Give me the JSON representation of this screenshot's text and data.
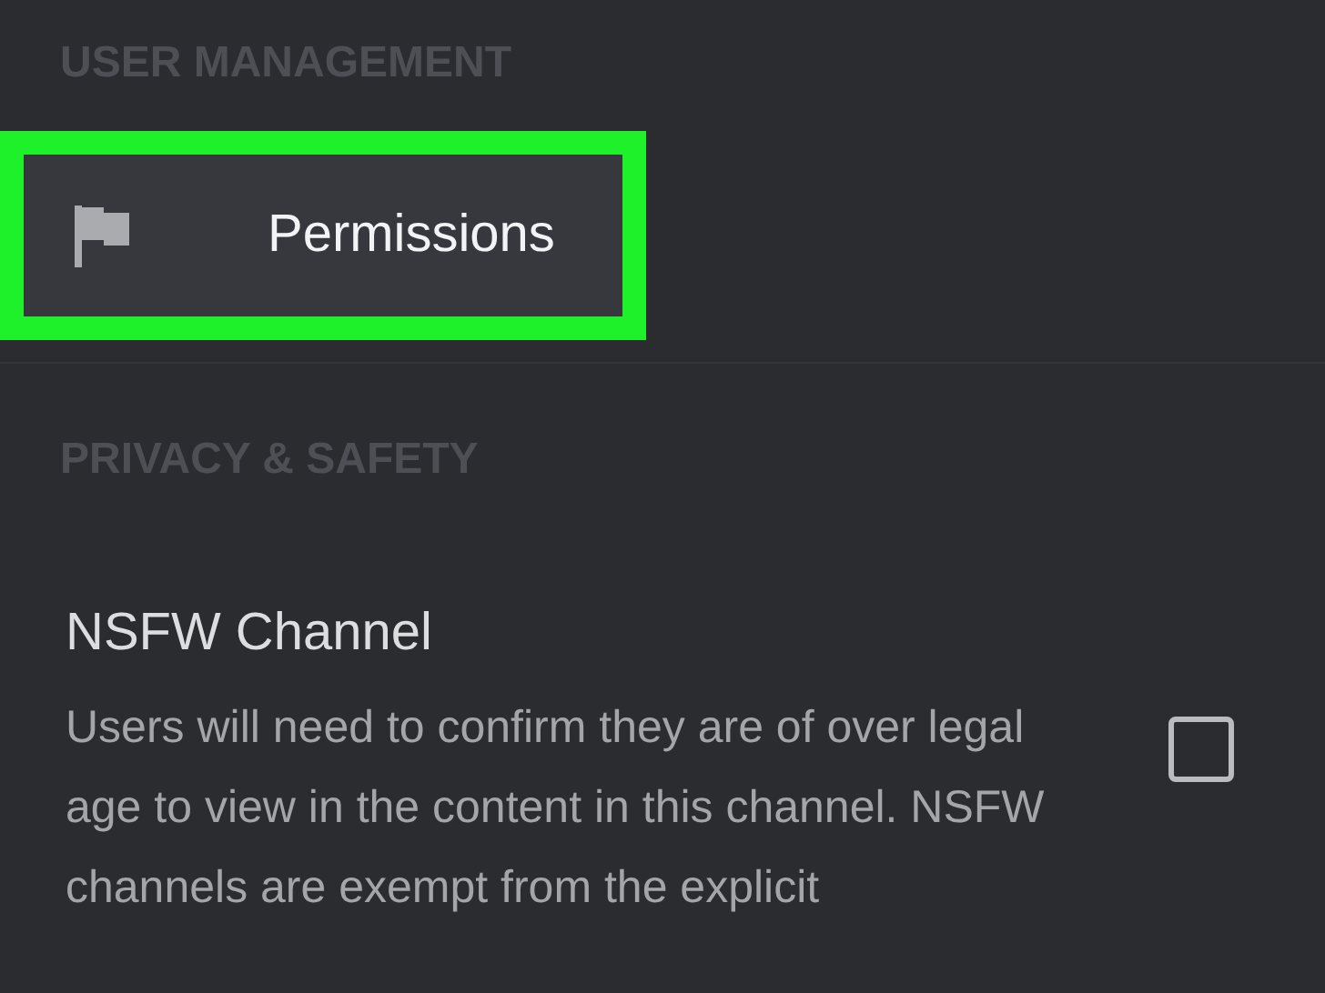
{
  "sections": [
    {
      "heading": "USER MANAGEMENT",
      "items": [
        {
          "kind": "nav",
          "label": "Permissions",
          "highlighted": true
        }
      ]
    },
    {
      "heading": "PRIVACY & SAFETY",
      "items": [
        {
          "kind": "toggle",
          "label": "NSFW Channel",
          "description": "Users will need to confirm they are of over legal age to view in the content in this channel. NSFW channels are exempt from the explicit",
          "checked": false
        }
      ]
    }
  ]
}
